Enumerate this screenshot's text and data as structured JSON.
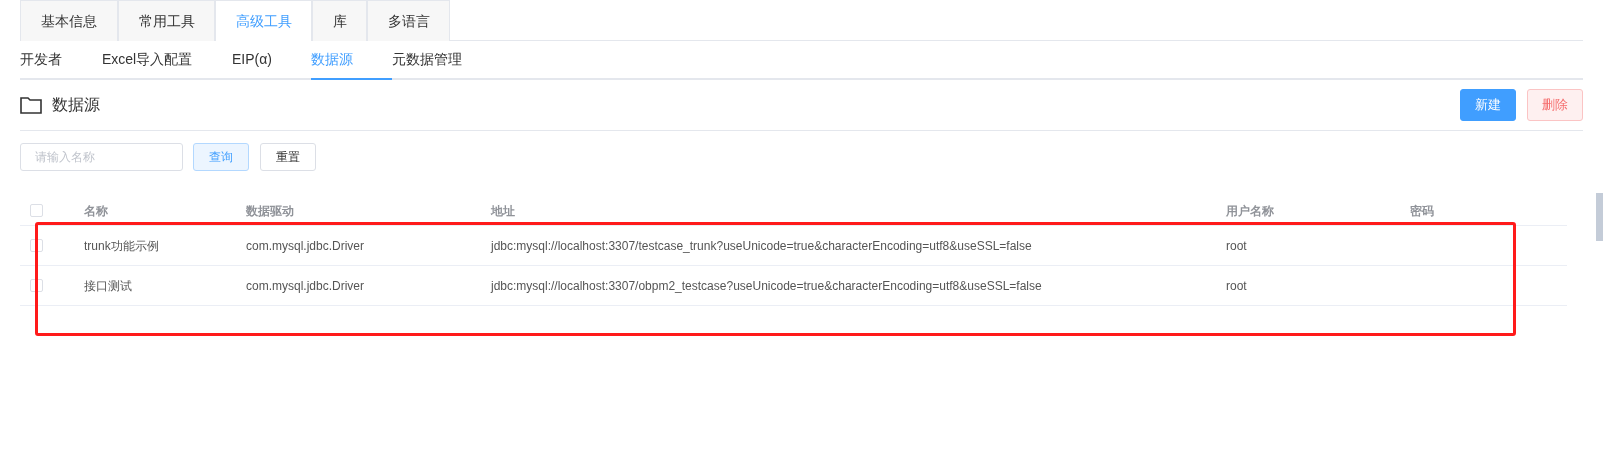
{
  "tabs": [
    {
      "label": "基本信息",
      "selected": false
    },
    {
      "label": "常用工具",
      "selected": false
    },
    {
      "label": "高级工具",
      "selected": true
    },
    {
      "label": "库",
      "selected": false
    },
    {
      "label": "多语言",
      "selected": false
    }
  ],
  "subtabs": [
    {
      "label": "开发者",
      "selected": false
    },
    {
      "label": "Excel导入配置",
      "selected": false
    },
    {
      "label": "EIP(α)",
      "selected": false
    },
    {
      "label": "数据源",
      "selected": true
    },
    {
      "label": "元数据管理",
      "selected": false
    }
  ],
  "header": {
    "title": "数据源",
    "buttons": [
      {
        "label": "新建",
        "kind": "primary"
      },
      {
        "label": "删除",
        "kind": "danger"
      }
    ]
  },
  "search": {
    "placeholder": "请输入名称",
    "buttons": [
      {
        "label": "查询",
        "kind": "query"
      },
      {
        "label": "重置",
        "kind": "plain"
      }
    ]
  },
  "table": {
    "select_all": {
      "checked": false
    },
    "columns": [
      "名称",
      "数据驱动",
      "地址",
      "用户名称",
      "密码"
    ],
    "rows": [
      {
        "checked": false,
        "cells": [
          "trunk功能示例",
          "com.mysql.jdbc.Driver",
          "jdbc:mysql://localhost:3307/testcase_trunk?useUnicode=true&characterEncoding=utf8&useSSL=false",
          "root"
        ]
      },
      {
        "checked": false,
        "cells": [
          "接口测试",
          "com.mysql.jdbc.Driver",
          "jdbc:mysql://localhost:3307/obpm2_testcase?useUnicode=true&characterEncoding=utf8&useSSL=false",
          "root"
        ]
      }
    ]
  }
}
